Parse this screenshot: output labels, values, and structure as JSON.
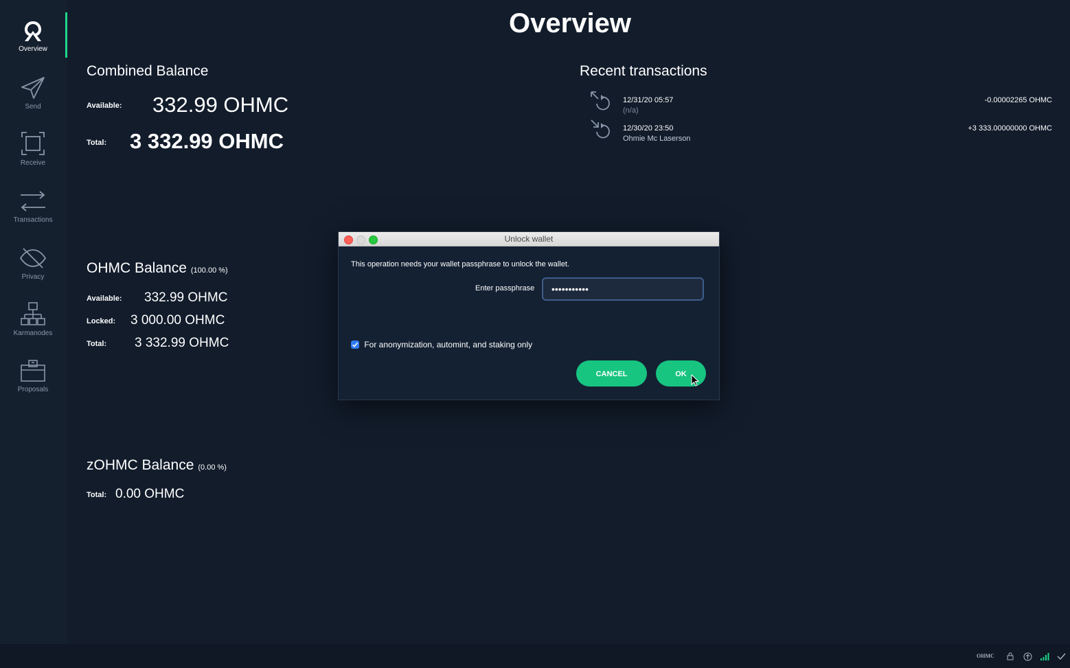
{
  "sidebar": {
    "items": [
      {
        "label": "Overview",
        "icon": "logo-icon",
        "active": true
      },
      {
        "label": "Send",
        "icon": "send-icon"
      },
      {
        "label": "Receive",
        "icon": "receive-icon"
      },
      {
        "label": "Transactions",
        "icon": "transactions-icon"
      },
      {
        "label": "Privacy",
        "icon": "privacy-icon"
      },
      {
        "label": "Karmanodes",
        "icon": "karmanodes-icon"
      },
      {
        "label": "Proposals",
        "icon": "proposals-icon"
      }
    ]
  },
  "main": {
    "title": "Overview",
    "combined": {
      "title": "Combined Balance",
      "available_label": "Available:",
      "available_value": "332.99 OHMC",
      "total_label": "Total:",
      "total_value": "3 332.99 OHMC"
    },
    "ohmc": {
      "title": "OHMC Balance",
      "pct": "(100.00 %)",
      "available_label": "Available:",
      "available_value": "332.99 OHMC",
      "locked_label": "Locked:",
      "locked_value": "3 000.00 OHMC",
      "total_label": "Total:",
      "total_value": "3 332.99 OHMC"
    },
    "zohmc": {
      "title": "zOHMC Balance",
      "pct": "(0.00 %)",
      "total_label": "Total:",
      "total_value": "0.00 OHMC"
    }
  },
  "recent": {
    "title": "Recent transactions",
    "items": [
      {
        "date": "12/31/20 05:57",
        "sub": "(n/a)",
        "amount": "-0.00002265 OHMC",
        "icon": "staking-icon"
      },
      {
        "date": "12/30/20 23:50",
        "sub": "Ohmie Mc Laserson",
        "amount": "+3 333.00000000 OHMC",
        "icon": "received-icon"
      }
    ]
  },
  "dialog": {
    "title": "Unlock wallet",
    "message": "This operation needs your wallet passphrase to unlock the wallet.",
    "passphrase_label": "Enter passphrase",
    "passphrase_value": "•••••••••••",
    "checkbox_label": "For anonymization, automint, and staking only",
    "checkbox_checked": true,
    "cancel_label": "CANCEL",
    "ok_label": "OK"
  },
  "statusbar": {
    "brand": "OHMC"
  },
  "colors": {
    "background": "#121c2b",
    "sidebar": "#15202f",
    "accent": "#17c480",
    "checkbox": "#2f7cf6"
  }
}
